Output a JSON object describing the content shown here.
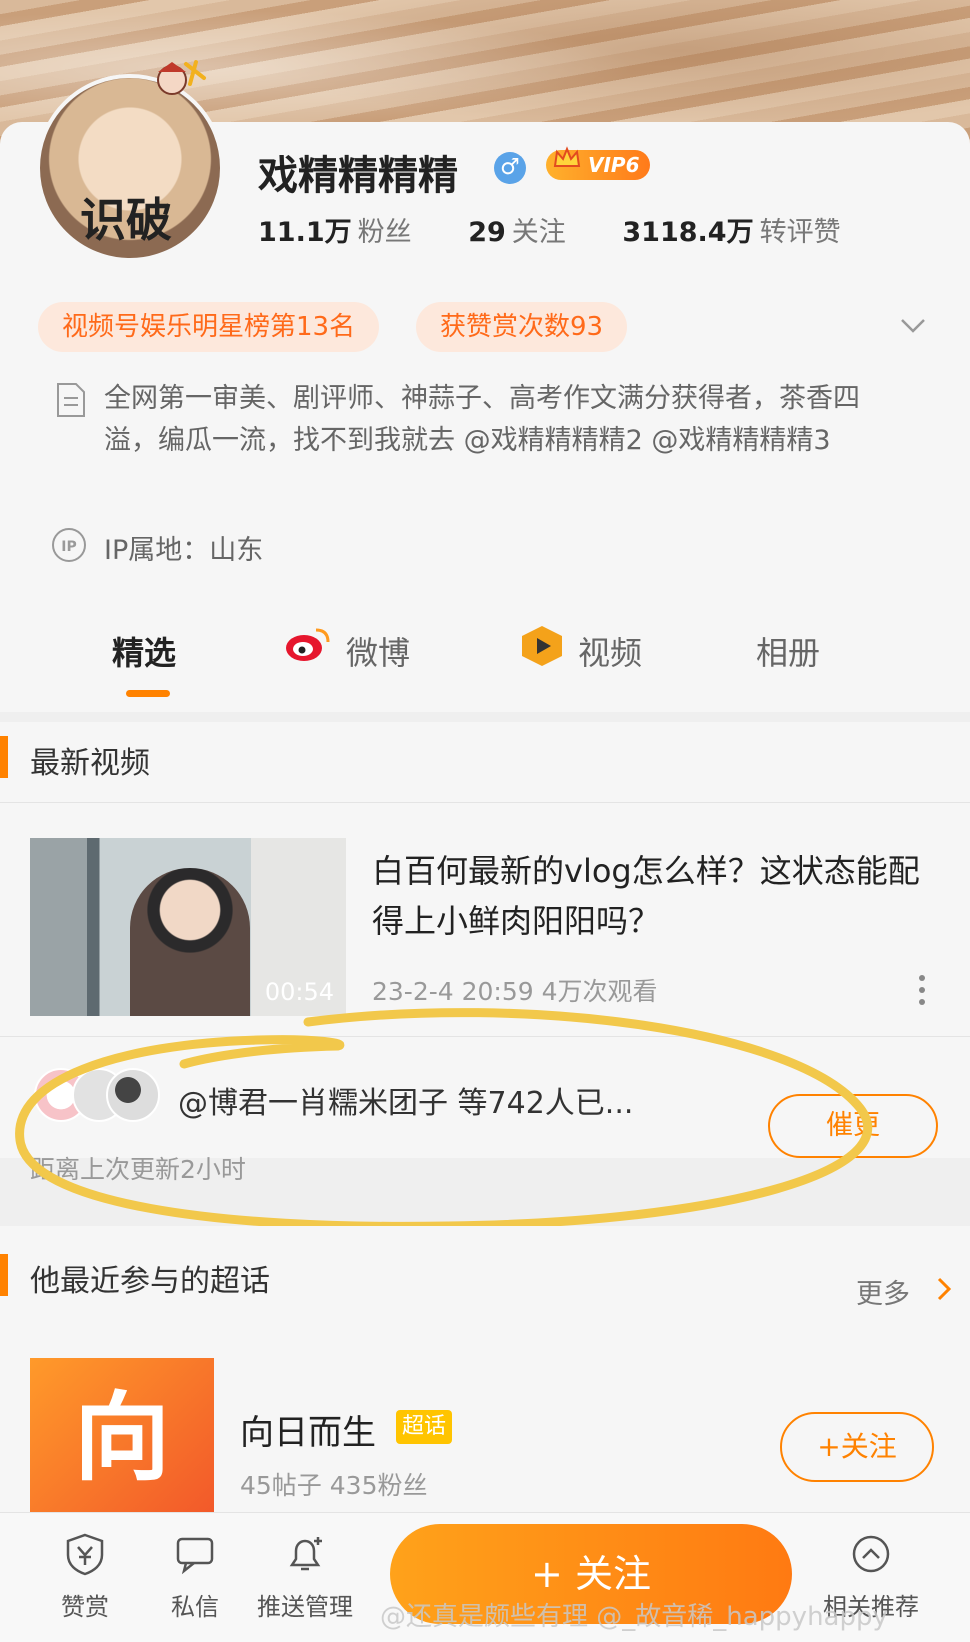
{
  "profile": {
    "avatar_caption": "识破",
    "username": "戏精精精精",
    "vip_label": "VIP6",
    "stats": [
      {
        "value": "11.1万",
        "label": "粉丝"
      },
      {
        "value": "29",
        "label": "关注"
      },
      {
        "value": "3118.4万",
        "label": "转评赞"
      }
    ],
    "tags": [
      "视频号娱乐明星榜第13名",
      "获赞赏次数93"
    ],
    "bio": "全网第一审美、剧评师、神蒜子、高考作文满分获得者，茶香四溢，编瓜一流，找不到我就去 @戏精精精精2 @戏精精精精3",
    "ip_icon": "IP",
    "ip_location": "IP属地：山东"
  },
  "tabs": [
    {
      "label": "精选"
    },
    {
      "label": "微博"
    },
    {
      "label": "视频"
    },
    {
      "label": "相册"
    }
  ],
  "latest_video": {
    "section_title": "最新视频",
    "title": "白百何最新的vlog怎么样？这状态能配得上小鲜肉阳阳吗？",
    "duration": "00:54",
    "meta": "23-2-4 20:59 4万次观看"
  },
  "subscribe": {
    "text": "@博君一肖糯米团子 等742人已...",
    "update_time": "距离上次更新2小时",
    "urge_label": "催更"
  },
  "supertopics": {
    "section_title": "他最近参与的超话",
    "more_label": "更多",
    "topic": {
      "cover_char": "向",
      "name": "向日而生",
      "badge": "超话",
      "stats": "45帖子 435粉丝",
      "follow_label": "+关注"
    }
  },
  "bottom_bar": {
    "items": [
      "赞赏",
      "私信",
      "推送管理",
      "相关推荐"
    ],
    "follow_label": "+ 关注"
  },
  "watermark": "@还真是颇些有理   @_故音稀_happyhappy",
  "colors": {
    "accent": "#ff8200",
    "tag_bg": "#fde8dc",
    "annotation": "#f2c84b"
  }
}
